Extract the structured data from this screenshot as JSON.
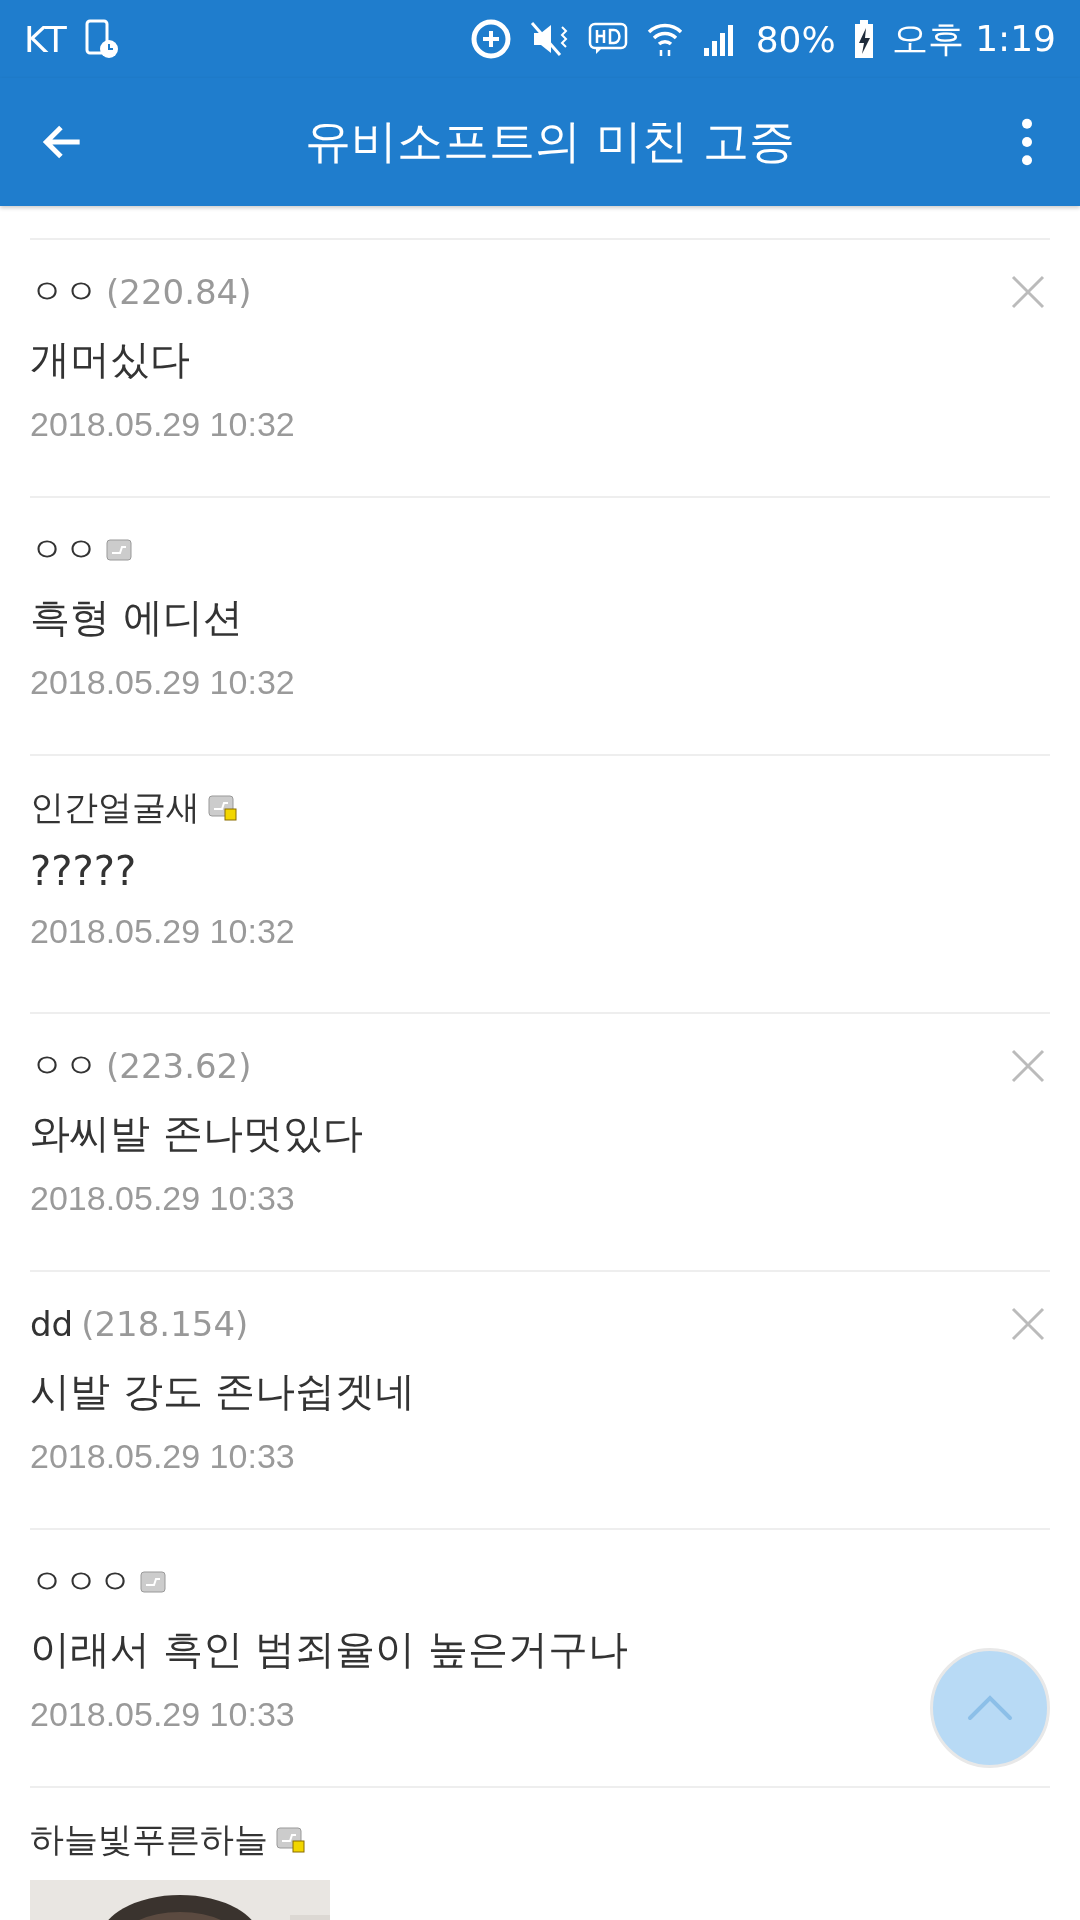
{
  "status_bar": {
    "carrier": "KT",
    "battery": "80%",
    "time": "오후 1:19"
  },
  "app_bar": {
    "title": "유비소프트의 미친 고증"
  },
  "comments": [
    {
      "kind": "guest",
      "author": "ㅇㅇ",
      "ip": "(220.84)",
      "deletable": true,
      "text": "개머싰다",
      "date": "2018.05.29 10:32"
    },
    {
      "kind": "semi_fixed",
      "author": "ㅇㅇ",
      "deletable": false,
      "text": "흑형 에디션",
      "date": "2018.05.29 10:32"
    },
    {
      "kind": "fixed",
      "author": "인간얼굴새",
      "deletable": false,
      "text": "?????",
      "date": "2018.05.29 10:32"
    },
    {
      "kind": "guest",
      "author": "ㅇㅇ",
      "ip": "(223.62)",
      "deletable": true,
      "text": "와씨발 존나멋있다",
      "date": "2018.05.29 10:33"
    },
    {
      "kind": "guest",
      "author": "dd",
      "ip": "(218.154)",
      "deletable": true,
      "text": "시발 강도 존나쉽겟네",
      "date": "2018.05.29 10:33"
    },
    {
      "kind": "semi_fixed",
      "author": "ㅇㅇㅇ",
      "deletable": false,
      "text": "이래서 흑인 범죄율이 높은거구나",
      "date": "2018.05.29 10:33"
    },
    {
      "kind": "fixed",
      "author": "하늘빛푸른하늘",
      "deletable": false
    }
  ]
}
